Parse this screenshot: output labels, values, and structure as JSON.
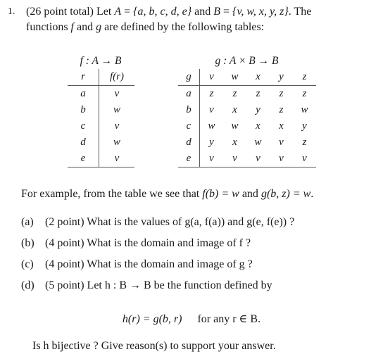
{
  "problem": {
    "number": "1.",
    "line1_pre": "(26 point total) Let ",
    "var_A": "A",
    "eq1": " = ",
    "set_A": "{a, b, c, d, e}",
    "line1_mid": " and ",
    "var_B": "B",
    "eq2": " = ",
    "set_B": "{v, w, x, y, z}",
    "line1_post": ". The",
    "line2_pre": "functions ",
    "fn_f": "f",
    "line2_mid": " and ",
    "fn_g": "g",
    "line2_post": " are defined by the following tables:"
  },
  "f_table": {
    "caption": "f : A → B",
    "header": [
      "r",
      "f(r)"
    ],
    "rows": [
      [
        "a",
        "v"
      ],
      [
        "b",
        "w"
      ],
      [
        "c",
        "v"
      ],
      [
        "d",
        "w"
      ],
      [
        "e",
        "v"
      ]
    ]
  },
  "g_table": {
    "caption": "g : A × B → B",
    "corner": "g",
    "col_headers": [
      "v",
      "w",
      "x",
      "y",
      "z"
    ],
    "row_headers": [
      "a",
      "b",
      "c",
      "d",
      "e"
    ],
    "rows": [
      [
        "z",
        "z",
        "z",
        "z",
        "z"
      ],
      [
        "v",
        "x",
        "y",
        "z",
        "w"
      ],
      [
        "w",
        "w",
        "x",
        "x",
        "y"
      ],
      [
        "y",
        "x",
        "w",
        "v",
        "z"
      ],
      [
        "v",
        "v",
        "v",
        "v",
        "v"
      ]
    ]
  },
  "example": {
    "pre": "For example, from the table we see that ",
    "expr1": "f(b) = w",
    "mid": " and ",
    "expr2": "g(b, z) = w",
    "post": "."
  },
  "questions": [
    {
      "label": "(a)",
      "text": "(2 point) What is the values of g(a, f(a)) and g(e, f(e)) ?"
    },
    {
      "label": "(b)",
      "text": "(4 point) What is the domain and image of f ?"
    },
    {
      "label": "(c)",
      "text": "(4 point) What is the domain and image of g ?"
    },
    {
      "label": "(d)",
      "text": "(5 point) Let h : B → B be the function defined by"
    }
  ],
  "display_equation": {
    "formula": "h(r) = g(b, r)",
    "condition": "for any r ∈ B."
  },
  "closing": "Is h bijective ? Give reason(s) to support your answer."
}
